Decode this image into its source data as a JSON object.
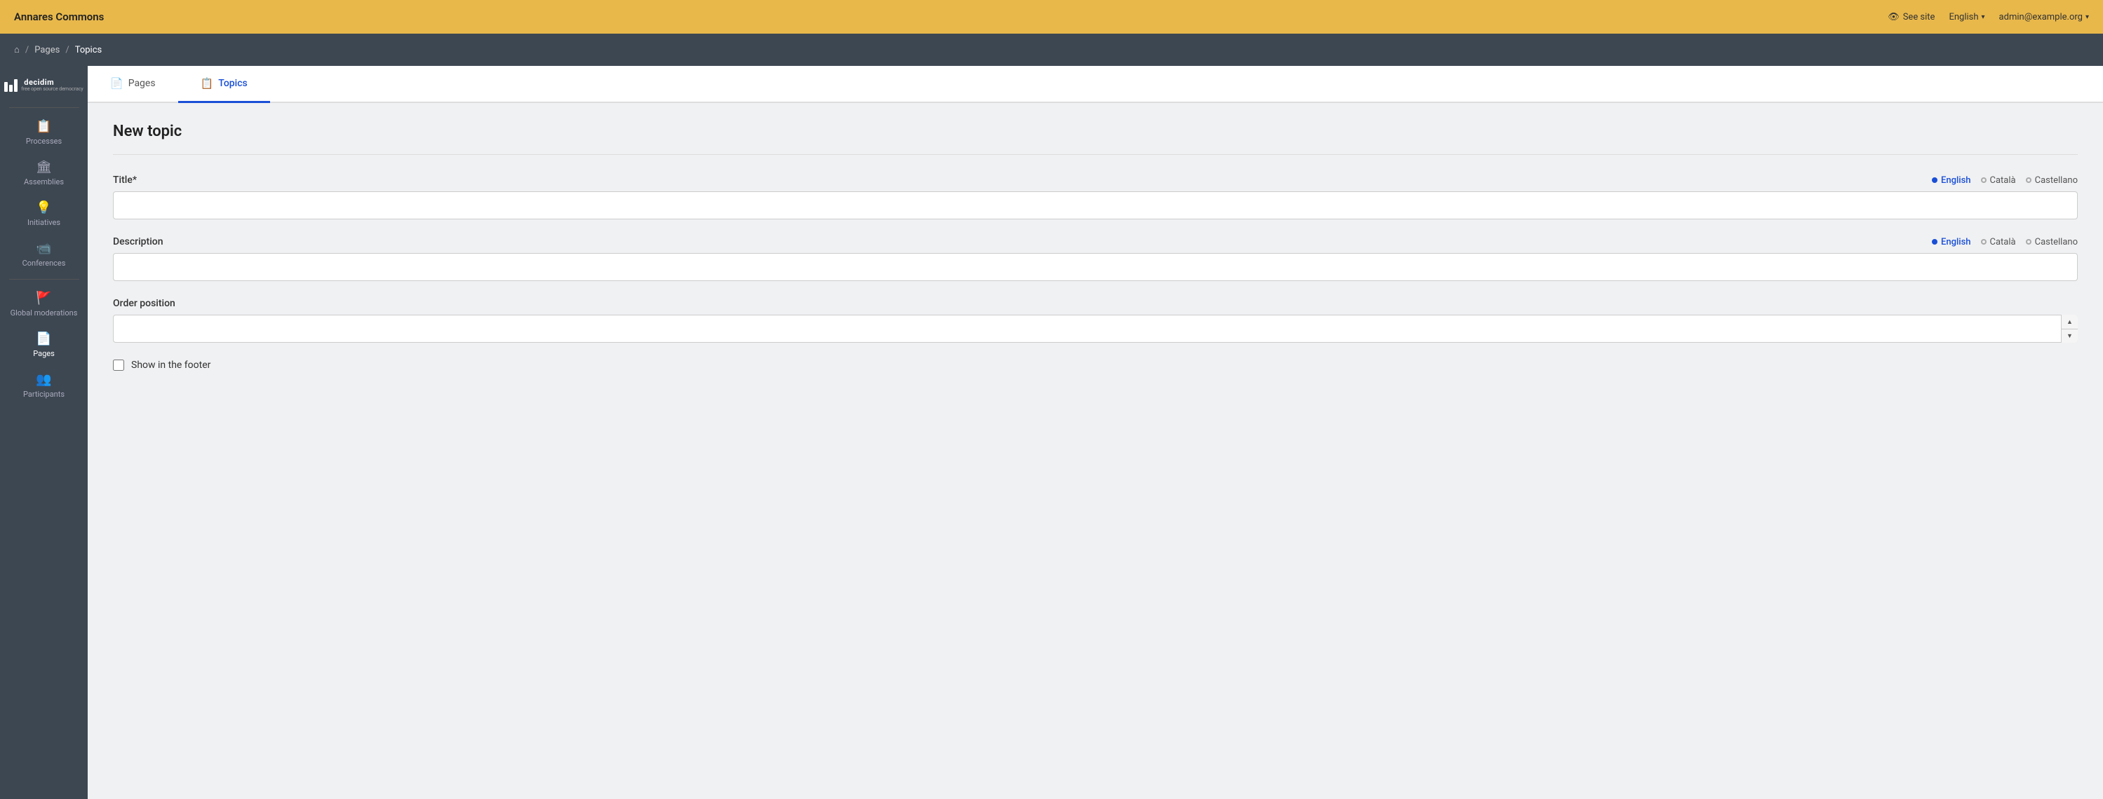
{
  "header": {
    "site_name": "Annares Commons",
    "see_site_label": "See site",
    "language": "English",
    "user": "admin@example.org"
  },
  "breadcrumb": {
    "home_label": "Home",
    "pages_label": "Pages",
    "topics_label": "Topics"
  },
  "sidebar": {
    "logo_text": "decidim",
    "logo_sub": "free open source democracy",
    "items": [
      {
        "id": "processes",
        "label": "Processes",
        "icon": "📋"
      },
      {
        "id": "assemblies",
        "label": "Assemblies",
        "icon": "🏛"
      },
      {
        "id": "initiatives",
        "label": "Initiatives",
        "icon": "💡"
      },
      {
        "id": "conferences",
        "label": "Conferences",
        "icon": "📹"
      },
      {
        "id": "global-moderations",
        "label": "Global moderations",
        "icon": "🚩"
      },
      {
        "id": "pages",
        "label": "Pages",
        "icon": "📄"
      },
      {
        "id": "participants",
        "label": "Participants",
        "icon": "👥"
      }
    ]
  },
  "tabs": [
    {
      "id": "pages",
      "label": "Pages",
      "icon": "📄",
      "active": false
    },
    {
      "id": "topics",
      "label": "Topics",
      "icon": "📋",
      "active": true
    }
  ],
  "form": {
    "title": "New topic",
    "title_field": {
      "label": "Title*",
      "placeholder": "",
      "value": ""
    },
    "description_field": {
      "label": "Description",
      "placeholder": "",
      "value": ""
    },
    "order_position_field": {
      "label": "Order position",
      "placeholder": "",
      "value": ""
    },
    "show_in_footer": {
      "label": "Show in the footer",
      "checked": false
    },
    "languages": [
      {
        "code": "en",
        "label": "English",
        "active": true
      },
      {
        "code": "ca",
        "label": "Català",
        "active": false
      },
      {
        "code": "es",
        "label": "Castellano",
        "active": false
      }
    ]
  },
  "icons": {
    "eye": "👁",
    "chevron_down": "▾",
    "home": "⌂"
  }
}
